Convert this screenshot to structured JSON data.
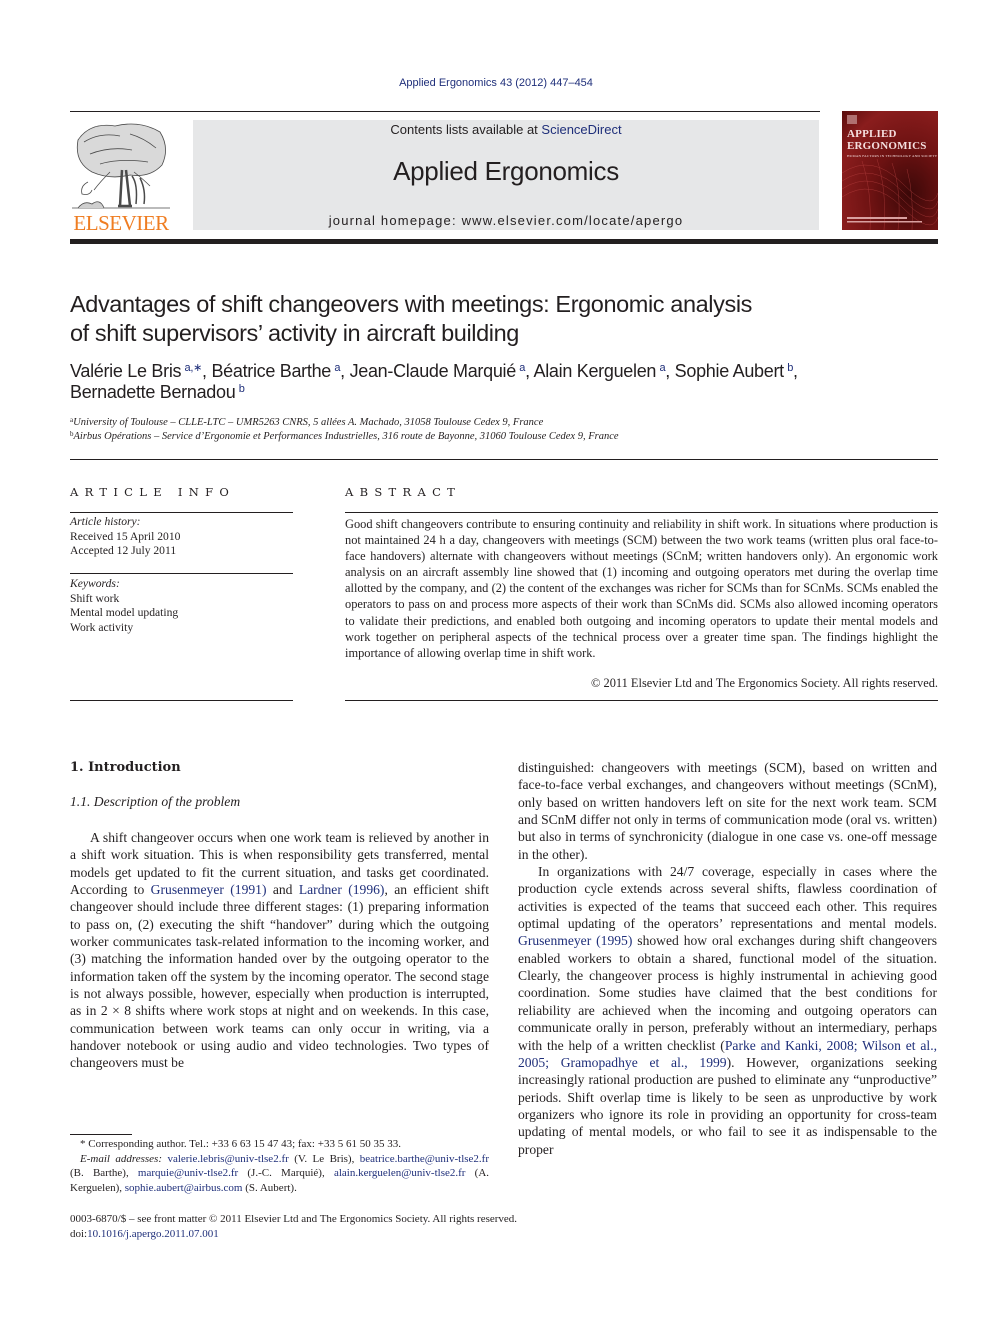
{
  "running_head": "Applied Ergonomics 43 (2012) 447–454",
  "masthead": {
    "publisher_logo_label": "ELSEVIER",
    "contents_prefix": "Contents lists available at ",
    "contents_link": "ScienceDirect",
    "journal_name": "Applied Ergonomics",
    "homepage_prefix": "journal homepage: ",
    "homepage_url": "www.elsevier.com/locate/apergo",
    "cover": {
      "line1": "APPLIED",
      "line2": "ERGONOMICS",
      "subtitle": "HUMAN FACTORS IN TECHNOLOGY AND SOCIETY"
    }
  },
  "article": {
    "title_line1": "Advantages of shift changeovers with meetings: Ergonomic analysis",
    "title_line2": "of shift supervisors’ activity in aircraft building",
    "authors": [
      {
        "name": "Valérie Le Bris",
        "sup": "a,∗",
        "sep": ", "
      },
      {
        "name": "Béatrice Barthe",
        "sup": "a",
        "sep": ", "
      },
      {
        "name": "Jean-Claude Marquié",
        "sup": "a",
        "sep": ", "
      },
      {
        "name": "Alain Kerguelen",
        "sup": "a",
        "sep": ", "
      },
      {
        "name": "Sophie Aubert",
        "sup": "b",
        "sep": ","
      },
      {
        "name": "Bernadette Bernadou",
        "sup": "b",
        "sep": ""
      }
    ],
    "affiliations": [
      {
        "key": "a",
        "text": "University of Toulouse – CLLE-LTC – UMR5263 CNRS, 5 allées A. Machado, 31058 Toulouse Cedex 9, France"
      },
      {
        "key": "b",
        "text": "Airbus Opérations – Service d’Ergonomie et Performances Industrielles, 316 route de Bayonne, 31060 Toulouse Cedex 9, France"
      }
    ]
  },
  "article_info": {
    "heading": "ARTICLE INFO",
    "history_label": "Article history:",
    "received": "Received 15 April 2010",
    "accepted": "Accepted 12 July 2011",
    "keywords_label": "Keywords:",
    "keywords": [
      "Shift work",
      "Mental model updating",
      "Work activity"
    ]
  },
  "abstract": {
    "heading": "ABSTRACT",
    "text": "Good shift changeovers contribute to ensuring continuity and reliability in shift work. In situations where production is not maintained 24 h a day, changeovers with meetings (SCM) between the two work teams (written plus oral face-to-face handovers) alternate with changeovers without meetings (SCnM; written handovers only). An ergonomic work analysis on an aircraft assembly line showed that (1) incoming and outgoing operators met during the overlap time allotted by the company, and (2) the content of the exchanges was richer for SCMs than for SCnMs. SCMs enabled the operators to pass on and process more aspects of their work than SCnMs did. SCMs also allowed incoming operators to validate their predictions, and enabled both outgoing and incoming operators to update their mental models and work together on peripheral aspects of the technical process over a greater time span. The findings highlight the importance of allowing overlap time in shift work.",
    "copyright": "© 2011 Elsevier Ltd and The Ergonomics Society. All rights reserved."
  },
  "body": {
    "section_heading": "1.  Introduction",
    "subsection_heading": "1.1.  Description of the problem",
    "left_p1": {
      "a": "A shift changeover occurs when one work team is relieved by another in a shift work situation. This is when responsibility gets transferred, mental models get updated to fit the current situation, and tasks get coordinated. According to ",
      "ref1": "Grusenmeyer (1991)",
      "b": " and ",
      "ref2": "Lardner (1996)",
      "c": ", an efficient shift changeover should include three different stages: (1) preparing information to pass on, (2) executing the shift “handover” during which the outgoing worker communicates task-related information to the incoming worker, and (3) matching the information handed over by the outgoing operator to the information taken off the system by the incoming operator. The second stage is not always possible, however, especially when production is interrupted, as in 2 × 8 shifts where work stops at night and on weekends. In this case, communication between work teams can only occur in writing, via a handover notebook or using audio and video technologies. Two types of changeovers must be"
    },
    "right_p1": "distinguished: changeovers with meetings (SCM), based on written and face-to-face verbal exchanges, and changeovers without meetings (SCnM), only based on written handovers left on site for the next work team. SCM and SCnM differ not only in terms of communication mode (oral vs. written) but also in terms of synchronicity (dialogue in one case vs. one-off message in the other).",
    "right_p2": {
      "a": "In organizations with 24/7 coverage, especially in cases where the production cycle extends across several shifts, flawless coordination of activities is expected of the teams that succeed each other. This requires optimal updating of the operators’ representations and mental models. ",
      "ref1": "Grusenmeyer (1995)",
      "b": " showed how oral exchanges during shift changeovers enabled workers to obtain a shared, functional model of the situation. Clearly, the changeover process is highly instrumental in achieving good coordination. Some studies have claimed that the best conditions for reliability are achieved when the incoming and outgoing operators can communicate orally in person, preferably without an intermediary, perhaps with the help of a written checklist (",
      "ref2": "Parke and Kanki, 2008; Wilson et al., 2005; Gramopadhye et al., 1999",
      "c": "). However, organizations seeking increasingly rational production are pushed to eliminate any “unproductive” periods. Shift overlap time is likely to be seen as unproductive by work organizers who ignore its role in providing an opportunity for cross-team updating of mental models, or who fail to see it as indispensable to the proper"
    }
  },
  "footnotes": {
    "corresponding": "* Corresponding author. Tel.: +33 6 63 15 47 43; fax: +33 5 61 50 35 33.",
    "email_label": "E-mail addresses:",
    "emails": [
      {
        "email": "valerie.lebris@univ-tlse2.fr",
        "who": " (V. Le Bris), "
      },
      {
        "email": "beatrice.barthe@univ-tlse2.fr",
        "who": " (B. Barthe), "
      },
      {
        "email": "marquie@univ-tlse2.fr",
        "who": " (J.-C. Marquié), "
      },
      {
        "email": "alain.kerguelen@univ-tlse2.fr",
        "who": " (A. Kerguelen), "
      },
      {
        "email": "sophie.aubert@airbus.com",
        "who": " (S. Aubert)."
      }
    ]
  },
  "bottom": {
    "issn_line": "0003-6870/$ – see front matter © 2011 Elsevier Ltd and The Ergonomics Society. All rights reserved.",
    "doi_label": "doi:",
    "doi": "10.1016/j.apergo.2011.07.001"
  },
  "colors": {
    "link": "#1f2f7a",
    "elsevier_orange": "#ef7d22",
    "banner_gray": "#e6e7e8",
    "cover_red": "#8a1d1d"
  }
}
